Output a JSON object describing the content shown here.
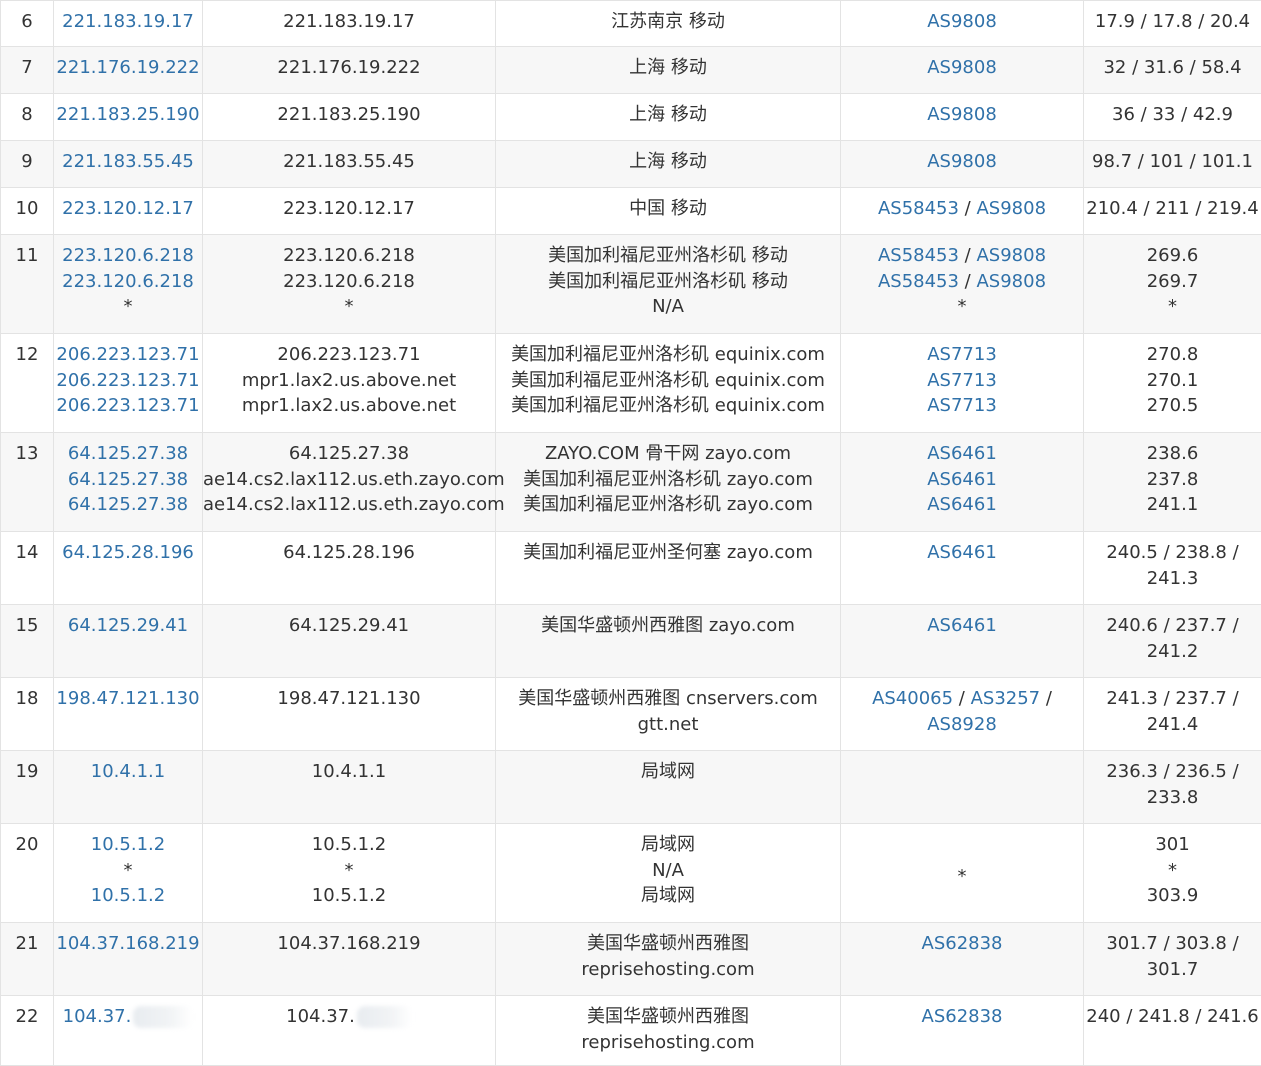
{
  "rows": [
    {
      "hop": "6",
      "ips": [
        "221.183.19.17"
      ],
      "hosts": [
        "221.183.19.17"
      ],
      "geo": [
        "江苏南京 移动"
      ],
      "asn": [
        [
          {
            "t": "AS9808",
            "link": true
          }
        ]
      ],
      "rtt": [
        "17.9 / 17.8 / 20.4"
      ],
      "h": 46
    },
    {
      "hop": "7",
      "ips": [
        "221.176.19.222"
      ],
      "hosts": [
        "221.176.19.222"
      ],
      "geo": [
        "上海 移动"
      ],
      "asn": [
        [
          {
            "t": "AS9808",
            "link": true
          }
        ]
      ],
      "rtt": [
        "32 / 31.6 / 58.4"
      ],
      "h": 47
    },
    {
      "hop": "8",
      "ips": [
        "221.183.25.190"
      ],
      "hosts": [
        "221.183.25.190"
      ],
      "geo": [
        "上海 移动"
      ],
      "asn": [
        [
          {
            "t": "AS9808",
            "link": true
          }
        ]
      ],
      "rtt": [
        "36 / 33 / 42.9"
      ],
      "h": 47
    },
    {
      "hop": "9",
      "ips": [
        "221.183.55.45"
      ],
      "hosts": [
        "221.183.55.45"
      ],
      "geo": [
        "上海 移动"
      ],
      "asn": [
        [
          {
            "t": "AS9808",
            "link": true
          }
        ]
      ],
      "rtt": [
        "98.7 / 101 / 101.1"
      ],
      "h": 47
    },
    {
      "hop": "10",
      "ips": [
        "223.120.12.17"
      ],
      "hosts": [
        "223.120.12.17"
      ],
      "geo": [
        "中国 移动"
      ],
      "asn": [
        [
          {
            "t": "AS58453",
            "link": true
          },
          {
            "t": " / ",
            "link": false
          },
          {
            "t": "AS9808",
            "link": true
          }
        ]
      ],
      "rtt": [
        "210.4 / 211 / 219.4"
      ],
      "h": 47
    },
    {
      "hop": "11",
      "ips": [
        "223.120.6.218",
        "223.120.6.218",
        "*"
      ],
      "hosts": [
        "223.120.6.218",
        "223.120.6.218",
        "*"
      ],
      "geo": [
        "美国加利福尼亚州洛杉矶 移动",
        "美国加利福尼亚州洛杉矶 移动",
        "N/A"
      ],
      "asn": [
        [
          {
            "t": "AS58453",
            "link": true
          },
          {
            "t": " / ",
            "link": false
          },
          {
            "t": "AS9808",
            "link": true
          }
        ],
        [
          {
            "t": "AS58453",
            "link": true
          },
          {
            "t": " / ",
            "link": false
          },
          {
            "t": "AS9808",
            "link": true
          }
        ],
        [
          {
            "t": "*",
            "link": false
          }
        ]
      ],
      "rtt": [
        "269.6",
        "269.7",
        "*"
      ],
      "h": 99
    },
    {
      "hop": "12",
      "ips": [
        "206.223.123.71",
        "206.223.123.71",
        "206.223.123.71"
      ],
      "hosts": [
        "206.223.123.71",
        "mpr1.lax2.us.above.net",
        "mpr1.lax2.us.above.net"
      ],
      "geo": [
        "美国加利福尼亚州洛杉矶 equinix.com",
        "美国加利福尼亚州洛杉矶 equinix.com",
        "美国加利福尼亚州洛杉矶 equinix.com"
      ],
      "asn": [
        [
          {
            "t": "AS7713",
            "link": true
          }
        ],
        [
          {
            "t": "AS7713",
            "link": true
          }
        ],
        [
          {
            "t": "AS7713",
            "link": true
          }
        ]
      ],
      "rtt": [
        "270.8",
        "270.1",
        "270.5"
      ],
      "h": 99
    },
    {
      "hop": "13",
      "ips": [
        "64.125.27.38",
        "64.125.27.38",
        "64.125.27.38"
      ],
      "hosts": [
        "64.125.27.38",
        "ae14.cs2.lax112.us.eth.zayo.com",
        "ae14.cs2.lax112.us.eth.zayo.com"
      ],
      "geo": [
        "ZAYO.COM 骨干网 zayo.com",
        "美国加利福尼亚州洛杉矶 zayo.com",
        "美国加利福尼亚州洛杉矶 zayo.com"
      ],
      "asn": [
        [
          {
            "t": "AS6461",
            "link": true
          }
        ],
        [
          {
            "t": "AS6461",
            "link": true
          }
        ],
        [
          {
            "t": "AS6461",
            "link": true
          }
        ]
      ],
      "rtt": [
        "238.6",
        "237.8",
        "241.1"
      ],
      "h": 99
    },
    {
      "hop": "14",
      "ips": [
        "64.125.28.196"
      ],
      "hosts": [
        "64.125.28.196"
      ],
      "geo": [
        "美国加利福尼亚州圣何塞 zayo.com"
      ],
      "asn": [
        [
          {
            "t": "AS6461",
            "link": true
          }
        ]
      ],
      "rtt": [
        "240.5 / 238.8 /",
        "241.3"
      ],
      "h": 73
    },
    {
      "hop": "15",
      "ips": [
        "64.125.29.41"
      ],
      "hosts": [
        "64.125.29.41"
      ],
      "geo": [
        "美国华盛顿州西雅图 zayo.com"
      ],
      "asn": [
        [
          {
            "t": "AS6461",
            "link": true
          }
        ]
      ],
      "rtt": [
        "240.6 / 237.7 /",
        "241.2"
      ],
      "h": 73
    },
    {
      "hop": "18",
      "ips": [
        "198.47.121.130"
      ],
      "hosts": [
        "198.47.121.130"
      ],
      "geo": [
        "美国华盛顿州西雅图 cnservers.com",
        "gtt.net"
      ],
      "asn": [
        [
          {
            "t": "AS40065",
            "link": true
          },
          {
            "t": " / ",
            "link": false
          },
          {
            "t": "AS3257",
            "link": true
          },
          {
            "t": " /",
            "link": false
          }
        ],
        [
          {
            "t": "AS8928",
            "link": true
          }
        ]
      ],
      "rtt": [
        "241.3 / 237.7 /",
        "241.4"
      ],
      "h": 73
    },
    {
      "hop": "19",
      "ips": [
        "10.4.1.1"
      ],
      "hosts": [
        "10.4.1.1"
      ],
      "geo": [
        "局域网"
      ],
      "asn": [],
      "rtt": [
        "236.3 / 236.5 /",
        "233.8"
      ],
      "h": 73
    },
    {
      "hop": "20",
      "ips": [
        "10.5.1.2",
        "*",
        "10.5.1.2"
      ],
      "hosts": [
        "10.5.1.2",
        "*",
        "10.5.1.2"
      ],
      "geo": [
        "局域网",
        "N/A",
        "局域网"
      ],
      "asn": [
        [],
        [
          {
            "t": "*",
            "link": false
          }
        ],
        []
      ],
      "rtt": [
        "301",
        "*",
        "303.9"
      ],
      "h": 99
    },
    {
      "hop": "21",
      "ips": [
        "104.37.168.219"
      ],
      "hosts": [
        "104.37.168.219"
      ],
      "geo": [
        "美国华盛顿州西雅图",
        "reprisehosting.com"
      ],
      "asn": [
        [
          {
            "t": "AS62838",
            "link": true
          }
        ]
      ],
      "rtt": [
        "301.7 / 303.8 /",
        "301.7"
      ],
      "h": 73
    },
    {
      "hop": "22",
      "ips": [
        "104.37."
      ],
      "hosts": [
        "104.37."
      ],
      "geo": [
        "美国华盛顿州西雅图",
        "reprisehosting.com"
      ],
      "asn": [
        [
          {
            "t": "AS62838",
            "link": true
          }
        ]
      ],
      "rtt": [
        "240 / 241.8 / 241.6"
      ],
      "h": 70,
      "redacted": true
    }
  ]
}
